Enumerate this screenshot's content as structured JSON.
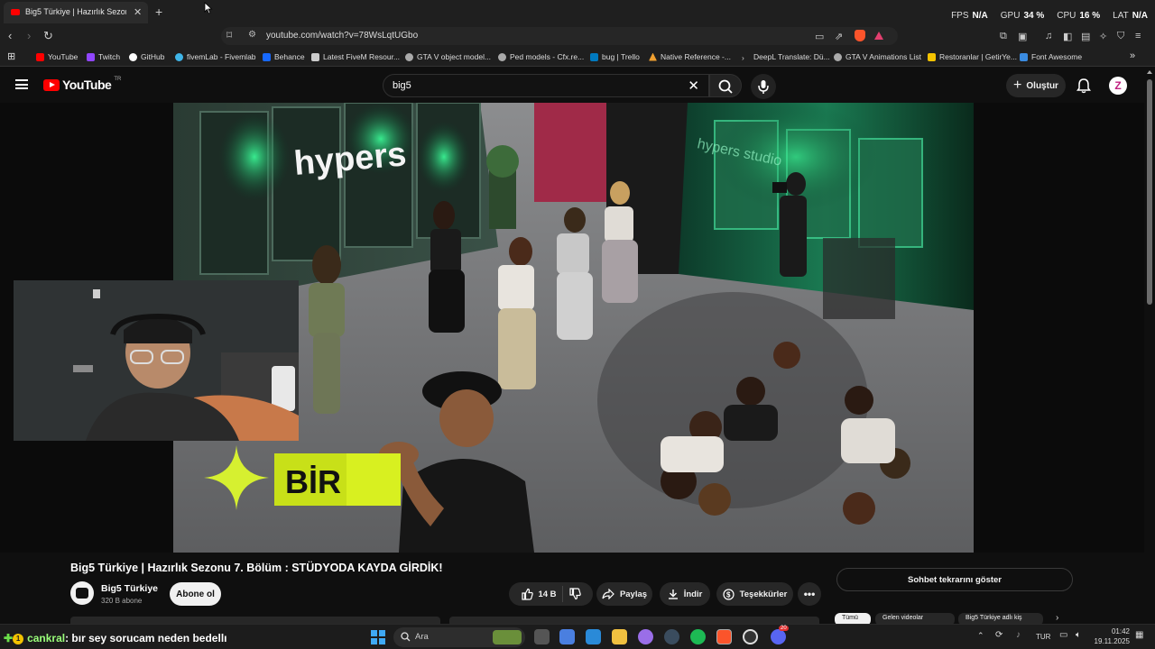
{
  "browser": {
    "tab_title": "Big5 Türkiye | Hazırlık Sezonu 7.",
    "url": "youtube.com/watch?v=78WsLqtUGbo",
    "perf": {
      "fps_label": "FPS",
      "fps_value": "N/A",
      "gpu_label": "GPU",
      "gpu_value": "34 %",
      "cpu_label": "CPU",
      "cpu_value": "16 %",
      "lat_label": "LAT",
      "lat_value": "N/A"
    },
    "bookmarks": [
      {
        "label": "YouTube",
        "icon": "youtube-icon",
        "color": "#ff0000"
      },
      {
        "label": "Twitch",
        "icon": "twitch-icon",
        "color": "#9146ff"
      },
      {
        "label": "GitHub",
        "icon": "github-icon",
        "color": "#ffffff"
      },
      {
        "label": "fivemLab - Fivemlab",
        "icon": "fivemlab-icon",
        "color": "#3fb5e8"
      },
      {
        "label": "Behance",
        "icon": "behance-icon",
        "color": "#1769ff"
      },
      {
        "label": "Latest FiveM Resour...",
        "icon": "fivem-icon",
        "color": "#cccccc"
      },
      {
        "label": "GTA V object model...",
        "icon": "gta-icon",
        "color": "#aaaaaa"
      },
      {
        "label": "Ped models - Cfx.re...",
        "icon": "cfx-icon",
        "color": "#aaaaaa"
      },
      {
        "label": "bug | Trello",
        "icon": "trello-icon",
        "color": "#0079bf"
      },
      {
        "label": "Native Reference -...",
        "icon": "native-icon",
        "color": "#f0a030"
      },
      {
        "label": "DeepL Translate: Dü...",
        "icon": "deepl-icon",
        "color": "#cccccc"
      },
      {
        "label": "GTA V Animations List",
        "icon": "gta-anim-icon",
        "color": "#aaaaaa"
      },
      {
        "label": "Restoranlar | GetirYe...",
        "icon": "getir-icon",
        "color": "#f5c300"
      },
      {
        "label": "Font Awesome",
        "icon": "fontawesome-icon",
        "color": "#3a8be0"
      }
    ]
  },
  "youtube": {
    "logo_text": "YouTube",
    "country_code": "TR",
    "search_query": "big5",
    "create_label": "Oluştur",
    "avatar_letter": "Z",
    "video": {
      "overlay_text": "hypers",
      "wall_text": "hypers studio",
      "banner_text": "BİR"
    },
    "title": "Big5 Türkiye | Hazırlık Sezonu 7. Bölüm : STÜDYODA KAYDA GİRDİK!",
    "channel_name": "Big5 Türkiye",
    "channel_subs": "320 B abone",
    "subscribe_label": "Abone ol",
    "like_count": "14 B",
    "share_label": "Paylaş",
    "download_label": "İndir",
    "thanks_label": "Teşekkürler",
    "chat_replay_label": "Sohbet tekrarını göster",
    "chips": [
      "Tümü",
      "Gelen videolar",
      "Big5 Türkiye adlı kiş"
    ]
  },
  "stream_chat": {
    "badge_count": "1",
    "username": "cankral",
    "message": ": bır sey sorucam neden bedellı"
  },
  "taskbar": {
    "search_placeholder": "Ara",
    "language": "TUR",
    "time": "01:42",
    "date": "19.11.2025",
    "discord_badge": "20"
  }
}
